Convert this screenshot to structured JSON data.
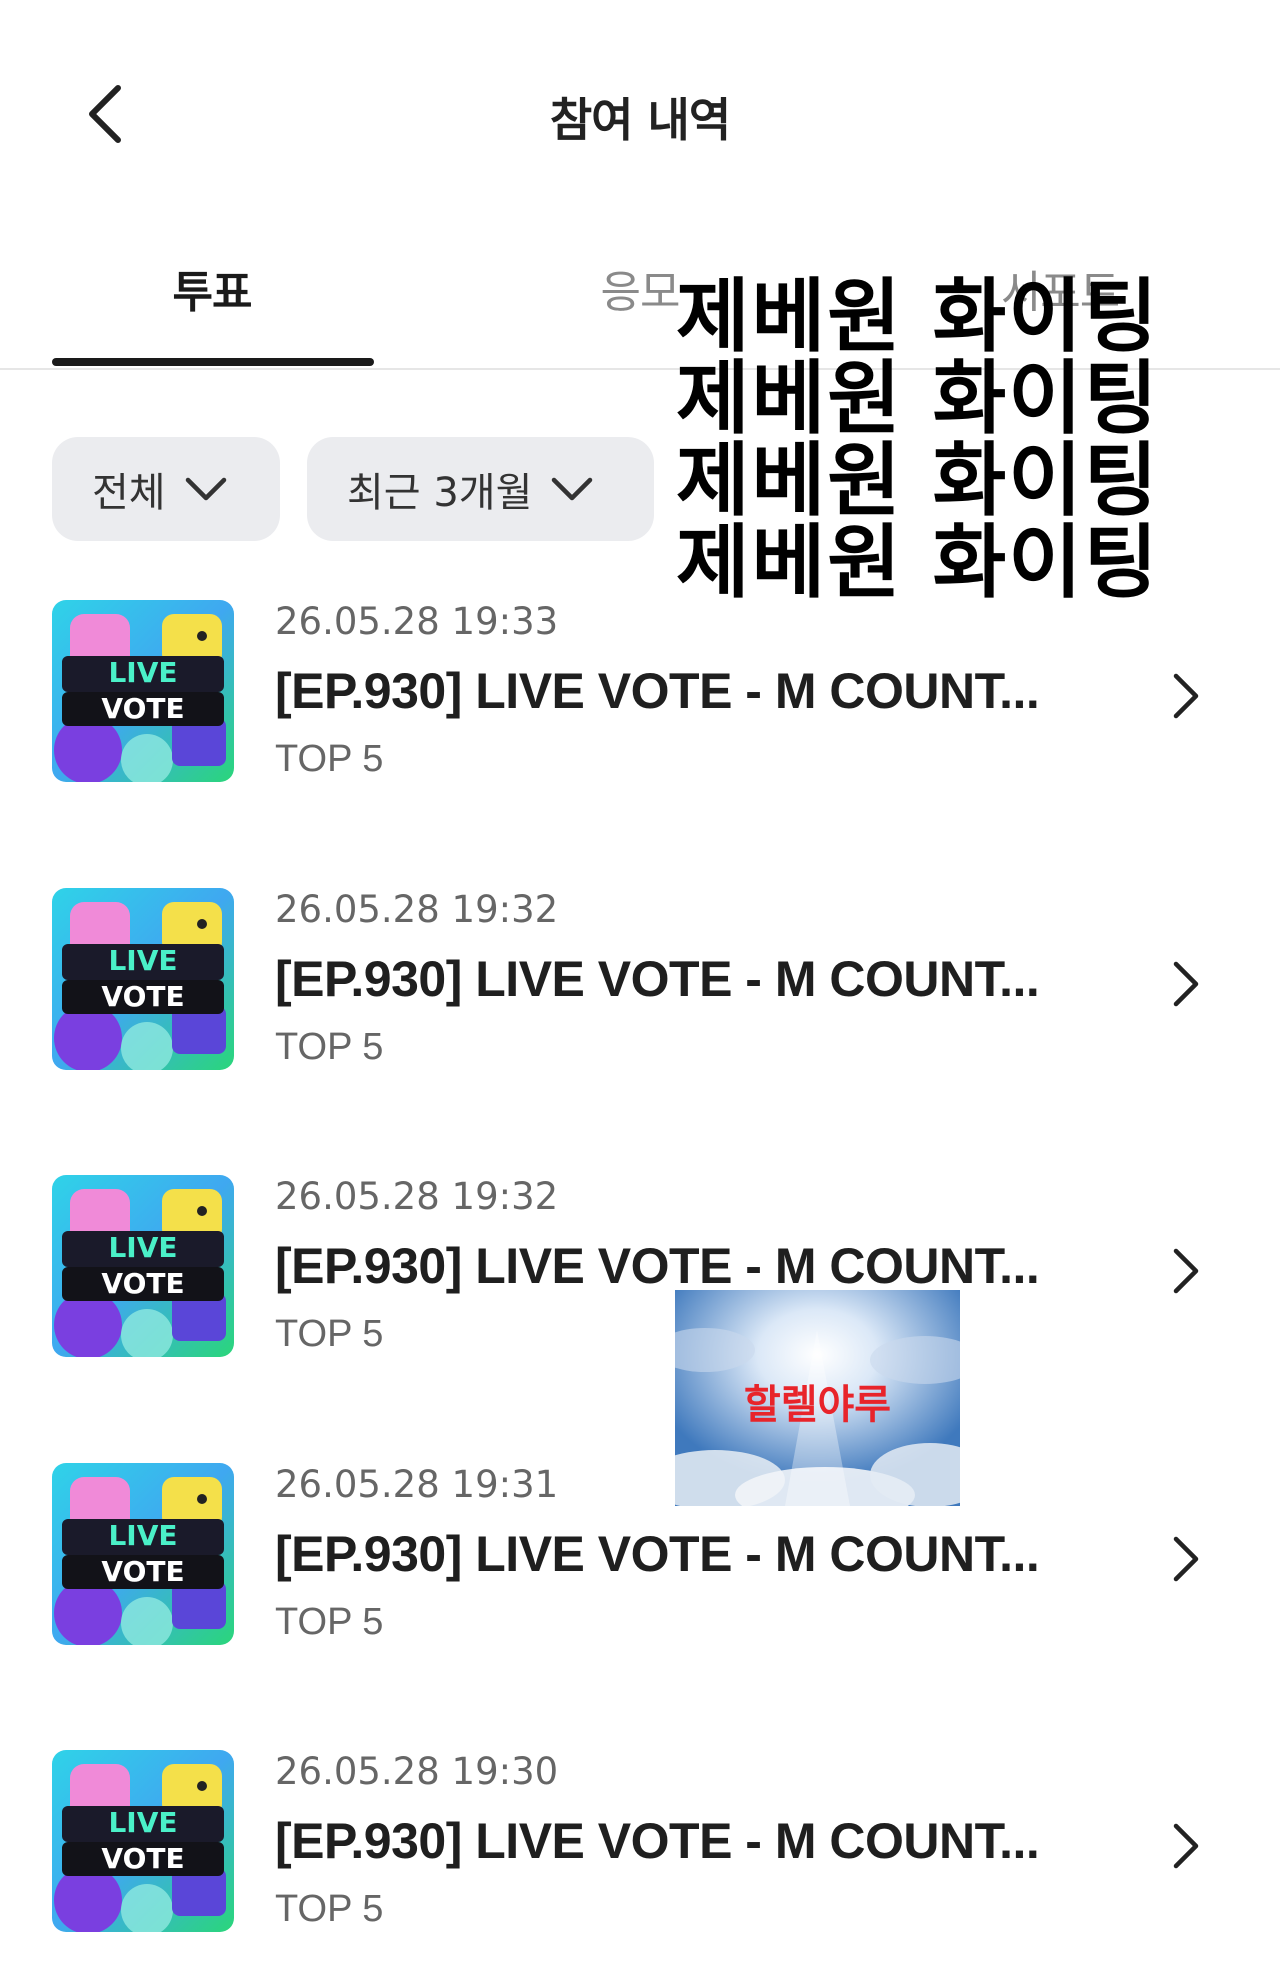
{
  "header": {
    "title": "참여 내역"
  },
  "tabs": [
    {
      "label": "투표",
      "active": true
    },
    {
      "label": "응모",
      "active": false
    },
    {
      "label": "서포트",
      "active": false
    }
  ],
  "filters": [
    {
      "label": "전체"
    },
    {
      "label": "최근 3개월"
    }
  ],
  "thumbnail": {
    "line1": "LIVE",
    "line2": "VOTE"
  },
  "items": [
    {
      "date": "26.05.28 19:33",
      "title": "[EP.930] LIVE VOTE - M COUNT...",
      "rank": "TOP 5"
    },
    {
      "date": "26.05.28 19:32",
      "title": "[EP.930] LIVE VOTE - M COUNT...",
      "rank": "TOP 5"
    },
    {
      "date": "26.05.28 19:32",
      "title": "[EP.930] LIVE VOTE - M COUNT...",
      "rank": "TOP 5"
    },
    {
      "date": "26.05.28 19:31",
      "title": "[EP.930] LIVE VOTE - M COUNT...",
      "rank": "TOP 5"
    },
    {
      "date": "26.05.28 19:30",
      "title": "[EP.930] LIVE VOTE - M COUNT...",
      "rank": "TOP 5"
    }
  ],
  "overlay": {
    "lines": [
      "제베원 화이팅",
      "제베원 화이팅",
      "제베원 화이팅",
      "제베원 화이팅"
    ]
  },
  "sticker": {
    "text": "할렐야루"
  },
  "colors": {
    "indicator": "#1a1a1a",
    "filter_bg": "#ebecef",
    "sticker_text": "#e8242a"
  }
}
